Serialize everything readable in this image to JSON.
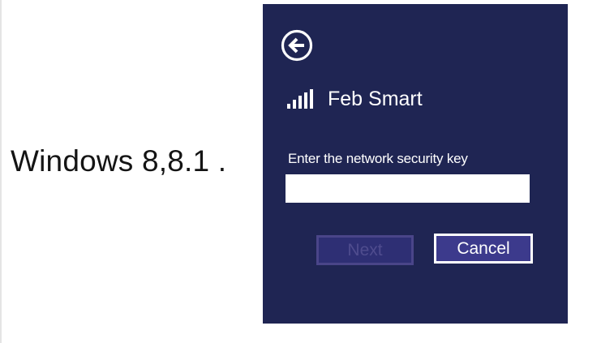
{
  "caption": {
    "text": "Windows 8,8.1 ."
  },
  "dialog": {
    "back_icon": "back-arrow-circle-icon",
    "network": {
      "signal_icon": "wifi-signal-bars-icon",
      "name": "Feb Smart"
    },
    "security_key": {
      "label": "Enter the network security key",
      "value": "",
      "placeholder": ""
    },
    "buttons": {
      "next_label": "Next",
      "next_state": "disabled",
      "cancel_label": "Cancel"
    },
    "colors": {
      "panel_background": "#1f2553",
      "cancel_button_background": "#3c3a8c",
      "next_button_disabled_text": "#4f4c8e",
      "text": "#ffffff"
    }
  }
}
